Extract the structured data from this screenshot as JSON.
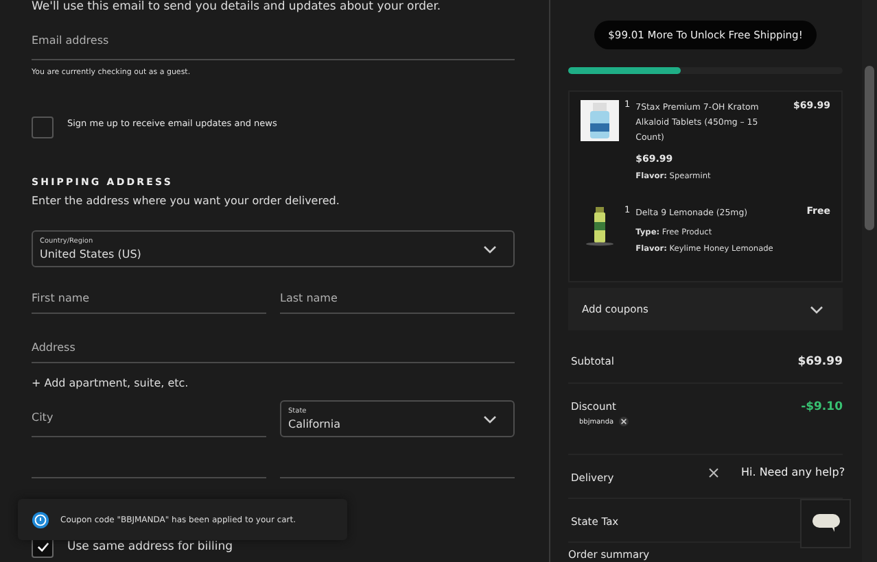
{
  "intro": "We'll use this email to send you details and updates about your order.",
  "email": {
    "placeholder": "Email address",
    "note": "You are currently checking out as a guest."
  },
  "newsletter": {
    "label": "Sign me up to receive email updates and news",
    "checked": false
  },
  "shipping": {
    "heading": "SHIPPING ADDRESS",
    "subtext": "Enter the address where you want your order delivered.",
    "country": {
      "label": "Country/Region",
      "value": "United States (US)"
    },
    "first_name": {
      "placeholder": "First name"
    },
    "last_name": {
      "placeholder": "Last name"
    },
    "address": {
      "placeholder": "Address"
    },
    "add_apartment": "+ Add apartment, suite, etc.",
    "city": {
      "placeholder": "City"
    },
    "state": {
      "label": "State",
      "value": "California"
    }
  },
  "toast": {
    "message": "Coupon code \"BBJMANDA\" has been applied to your cart."
  },
  "billing": {
    "label": "Use same address for billing",
    "checked": true
  },
  "cart": {
    "shipping_banner": "$99.01 More To Unlock Free Shipping!",
    "shipping_progress": {
      "level": 0.41
    },
    "items": [
      {
        "kind": "bottle",
        "quantity": "1",
        "name": "7Stax Premium 7-OH Kratom Alkaloid Tablets (450mg – 15 Count)",
        "price": "$69.99",
        "unit_price": "$69.99",
        "attributes": [
          {
            "label": "Flavor:",
            "value": "Spearmint"
          }
        ]
      },
      {
        "kind": "can",
        "quantity": "1",
        "name": "Delta 9 Lemonade (25mg)",
        "price": "Free",
        "attributes": [
          {
            "label": "Type:",
            "value": "Free Product"
          },
          {
            "label": "Flavor:",
            "value": "Keylime Honey Lemonade"
          }
        ]
      }
    ],
    "coupons": "Add coupons",
    "totals": [
      {
        "label": "Subtotal",
        "value": "$69.99"
      },
      {
        "label": "Discount",
        "value": "-$9.10",
        "coupon": "bbjmanda"
      },
      {
        "label": "Delivery"
      },
      {
        "label": "State Tax"
      }
    ],
    "order_summary": "Order summary"
  },
  "chat": {
    "prompt": "Hi. Need any help?"
  }
}
